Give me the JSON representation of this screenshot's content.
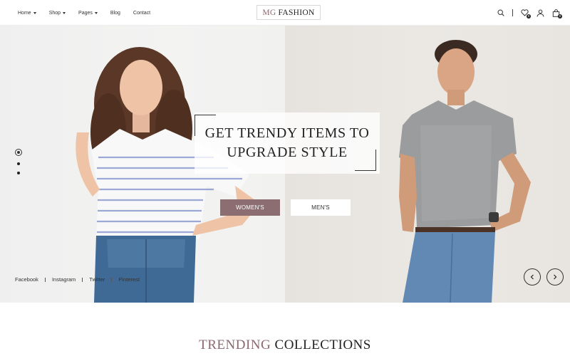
{
  "nav": {
    "items": [
      {
        "label": "Home",
        "dropdown": true
      },
      {
        "label": "Shop",
        "dropdown": true
      },
      {
        "label": "Pages",
        "dropdown": true
      },
      {
        "label": "Blog",
        "dropdown": false
      },
      {
        "label": "Contact",
        "dropdown": false
      }
    ]
  },
  "logo": {
    "prefix": "MG",
    "name": "FASHION"
  },
  "tools": {
    "icons": [
      "search-icon",
      "heart-icon",
      "user-icon",
      "bag-icon"
    ],
    "wishlist_count": "0",
    "cart_count": "0"
  },
  "hero": {
    "title_line1": "GET TRENDY ITEMS TO",
    "title_line2": "UPGRADE STYLE",
    "women_button": "WOMEN'S",
    "men_button": "MEN'S",
    "slides_total": 3,
    "slide_active": 1
  },
  "socials": [
    "Facebook",
    "Instagram",
    "Twitter",
    "Pinterest"
  ],
  "section": {
    "title_part1": "TRENDING",
    "title_part2": "COLLECTIONS"
  },
  "colors": {
    "accent": "#8b6d72",
    "text": "#222222"
  }
}
